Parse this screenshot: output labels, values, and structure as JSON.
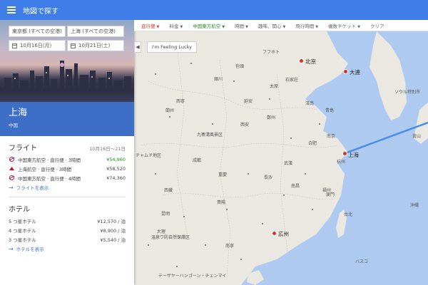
{
  "app": {
    "title": "地図で探す"
  },
  "search": {
    "origin": "東京都 (すべての空港)",
    "destination": "上海 (すべての空港)",
    "depart_date": "10月16日(月)",
    "return_date": "10月21日(土)"
  },
  "destination_card": {
    "city": "上海",
    "country": "中国"
  },
  "flights": {
    "title": "フライト",
    "dates": "10月16日〜21日",
    "rows": [
      {
        "label": "中国東方航空 · 直行便 · 3時間",
        "price": "¥54,960",
        "best": true
      },
      {
        "label": "上海航空 · 直行便 · 3時間",
        "price": "¥58,520",
        "best": false
      },
      {
        "label": "中国東方航空 · 直行便 · 4時間",
        "price": "¥74,360",
        "best": false
      }
    ],
    "show_link": "フライトを表示"
  },
  "hotels": {
    "title": "ホテル",
    "rows": [
      {
        "label": "5 つ星ホテル",
        "price": "¥12,570 / 泊"
      },
      {
        "label": "4 つ星ホテル",
        "price": "¥8,900 / 泊"
      },
      {
        "label": "3 つ星ホテル",
        "price": "¥5,540 / 泊"
      }
    ],
    "show_link": "ホテルを表示"
  },
  "filters": [
    {
      "label": "直行便",
      "color": "red",
      "caret": true
    },
    {
      "label": "料金",
      "color": "grey",
      "caret": true
    },
    {
      "label": "中国東方航空",
      "color": "green",
      "caret": true
    },
    {
      "label": "時間",
      "color": "grey",
      "caret": true
    },
    {
      "label": "趣味、関心",
      "color": "grey",
      "caret": true
    },
    {
      "label": "飛行時間",
      "color": "grey",
      "caret": true
    },
    {
      "label": "複数チケット",
      "color": "grey",
      "caret": true
    },
    {
      "label": "クリア",
      "color": "grey",
      "caret": false
    }
  ],
  "map": {
    "lucky_button": "I'm Feeling Lucky",
    "pins": [
      "北京",
      "大連",
      "上海",
      "広州"
    ],
    "labels": [
      "フフホト",
      "包頭",
      "銀川",
      "蘭州",
      "西寧",
      "延安",
      "太原",
      "石家荘",
      "済南",
      "青島",
      "西安",
      "鄭州",
      "合肥",
      "南京",
      "杭州",
      "武漢",
      "長沙",
      "南昌",
      "福州",
      "重慶",
      "成都",
      "九寨溝風景区",
      "チャムド地区",
      "貴陽",
      "昆明",
      "大理",
      "南寧",
      "廈門",
      "台北",
      "ソウル特別市",
      "釜山",
      "沖縄",
      "テーザヤーハンゴーン・チェンマイ",
      "温泉ワ防自然保護区",
      "西藏",
      "バスコ"
    ]
  },
  "colors": {
    "topbar": "#3f7ee8",
    "accent": "#3e6fc6",
    "pin": "#d93025",
    "route": "#4a8de8",
    "best_price": "#2a8a2a"
  }
}
